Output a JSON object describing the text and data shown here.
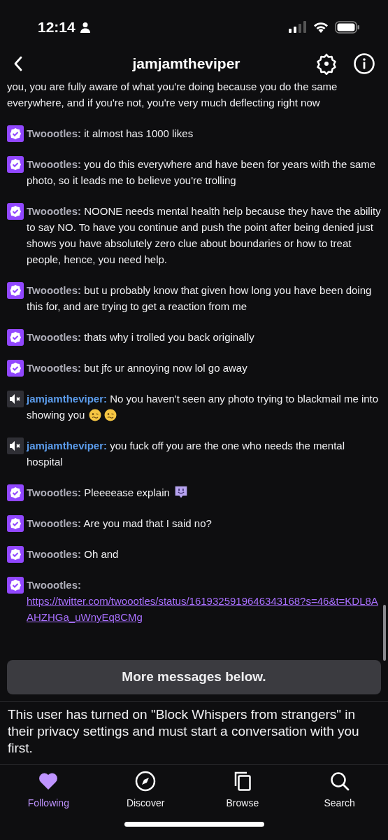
{
  "status_bar": {
    "time": "12:14"
  },
  "header": {
    "title": "jamjamtheviper"
  },
  "messages": [
    {
      "kind": "continuation",
      "text": "you, you are fully aware of what you're doing because you do the same everywhere, and if you're not, you're very much deflecting right now"
    },
    {
      "kind": "verified",
      "sender": "Twoootles:",
      "text": "it almost has 1000 likes"
    },
    {
      "kind": "verified",
      "sender": "Twoootles:",
      "text": "you do this everywhere and have been for years with the same photo, so it leads me to believe you're trolling"
    },
    {
      "kind": "verified",
      "sender": "Twoootles:",
      "text": "NOONE needs mental health help because they have the ability to say NO. To have you continue and push the point after being denied just shows you have absolutely zero clue about boundaries or how to treat people, hence, you need help."
    },
    {
      "kind": "verified",
      "sender": "Twoootles:",
      "text": "but u probably know that given how long you have been doing this for, and are trying to get a reaction from me"
    },
    {
      "kind": "verified",
      "sender": "Twoootles:",
      "text": "thats why i trolled you back originally"
    },
    {
      "kind": "verified",
      "sender": "Twoootles:",
      "text": "but jfc ur annoying now lol go away"
    },
    {
      "kind": "muted",
      "sender": "jamjamtheviper:",
      "text": "No you haven't seen any photo trying to blackmail me into showing you",
      "emotes": [
        {
          "kind": "woozy"
        },
        {
          "kind": "woozy"
        }
      ]
    },
    {
      "kind": "muted",
      "sender": "jamjamtheviper:",
      "text": "you fuck off you are the one who needs the mental hospital"
    },
    {
      "kind": "verified",
      "sender": "Twoootles:",
      "text": "Pleeeease explain",
      "emotes": [
        {
          "kind": "glitch"
        }
      ]
    },
    {
      "kind": "verified",
      "sender": "Twoootles:",
      "text": "Are you mad that I said no?"
    },
    {
      "kind": "verified",
      "sender": "Twoootles:",
      "text": "Oh and"
    },
    {
      "kind": "verified",
      "sender": "Twoootles:",
      "link": "https://twitter.com/twoootles/status/1619325919646343168?s=46&t=KDL8AAHZHGa_uWnyEq8CMg"
    }
  ],
  "banner": "More messages below.",
  "notice": "This user has turned on \"Block Whispers from strangers\" in their privacy settings and must start a conversation with you first.",
  "tabs": [
    {
      "label": "Following",
      "kind": "heart",
      "selected": true
    },
    {
      "label": "Discover",
      "kind": "compass",
      "selected": false
    },
    {
      "label": "Browse",
      "kind": "browse",
      "selected": false
    },
    {
      "label": "Search",
      "kind": "search",
      "selected": false
    }
  ]
}
